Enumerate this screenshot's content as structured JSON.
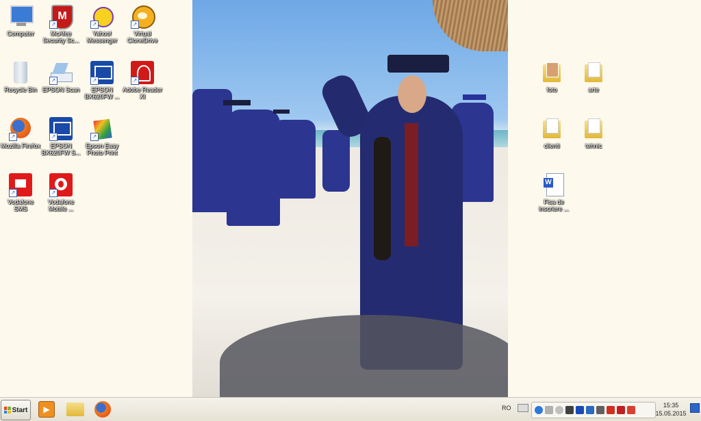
{
  "desktop_icons": {
    "computer": "Computer",
    "mcafee": "McAfee Security Sc...",
    "yahoo": "Yahoo! Messenger",
    "virtual_clonedrive": "Virtual CloneDrive",
    "recycle_bin": "Recycle Bin",
    "epson_scan": "EPSON Scan",
    "epson_bx620_1": "EPSON BX620FW ...",
    "adobe_reader": "Adobe Reader XI",
    "firefox": "Mozilla Firefox",
    "epson_bx620_2": "EPSON BX620FW S...",
    "epson_easy": "Epson Easy Photo Print",
    "vodafone_sms": "Vodafone SMS",
    "vodafone_mobile": "Vodafone Mobile ...",
    "folder_foto": "foto",
    "folder_arte": "arte",
    "folder_clienti": "clienti",
    "folder_tehnic": "tehnic",
    "doc_fisa": "Fisa de inscriere ..."
  },
  "taskbar": {
    "start_label": "Start",
    "language": "RO",
    "time": "15:35",
    "date": "15.05.2015"
  },
  "colors": {
    "desktop_bg": "#fdf9ec",
    "taskbar_bg": "#ece8dc",
    "gown_blue": "#2c3590"
  }
}
